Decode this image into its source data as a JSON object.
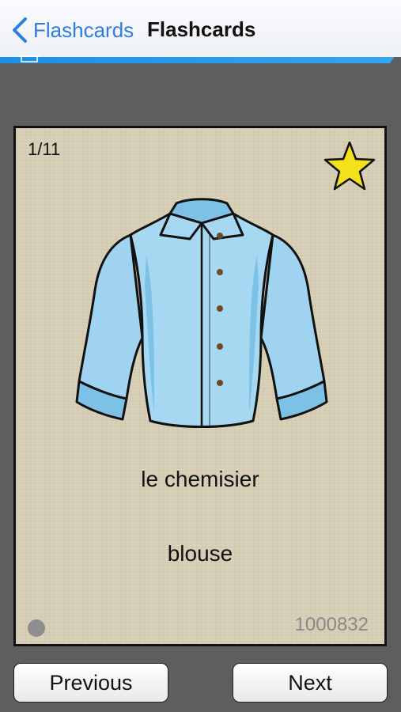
{
  "navbar": {
    "back_label": "Flashcards",
    "title": "Flashcards"
  },
  "card": {
    "counter": "1/11",
    "favorite_icon": "star-icon",
    "favorite_color": "#f5e11a",
    "image": "shirt-illustration",
    "word_french": "le chemisier",
    "word_english": "blouse",
    "card_id": "1000832"
  },
  "buttons": {
    "previous_label": "Previous",
    "next_label": "Next"
  },
  "colors": {
    "accent": "#2f7de0",
    "card_background": "#d9d0b7",
    "screen_background": "#5e5e5e",
    "shirt_fill": "#9fd3ef"
  }
}
